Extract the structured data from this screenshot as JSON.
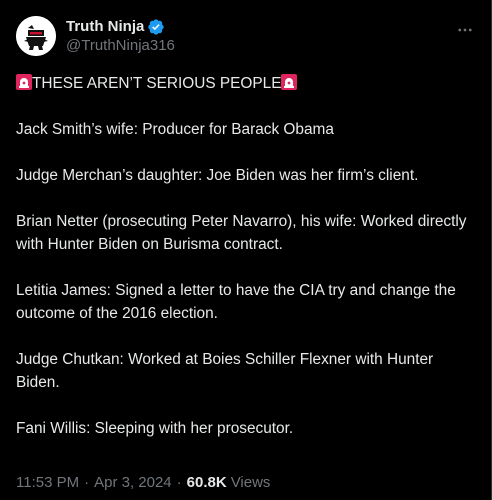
{
  "author": {
    "display_name": "Truth Ninja",
    "handle": "@TruthNinja316"
  },
  "more_icon": "more-horizontal-icon",
  "verified_icon": "verified-badge-icon",
  "accent_colors": {
    "verified": "#1d9bf0",
    "siren": "#e0245e"
  },
  "tweet": {
    "headline": "THESE AREN’T SERIOUS PEOPLE",
    "paragraphs": [
      "Jack Smith’s wife: Producer for Barack Obama",
      "Judge Merchan’s daughter: Joe Biden was her firm’s client.",
      "Brian Netter (prosecuting Peter Navarro), his wife: Worked directly with Hunter Biden on Burisma contract.",
      "Letitia James: Signed a letter to have the CIA try and change the outcome of the 2016 election.",
      "Judge Chutkan: Worked at Boies Schiller Flexner with Hunter Biden.",
      "Fani Willis: Sleeping with her prosecutor."
    ]
  },
  "meta": {
    "time": "11:53 PM",
    "date": "Apr 3, 2024",
    "views_count": "60.8K",
    "views_label": "Views"
  }
}
